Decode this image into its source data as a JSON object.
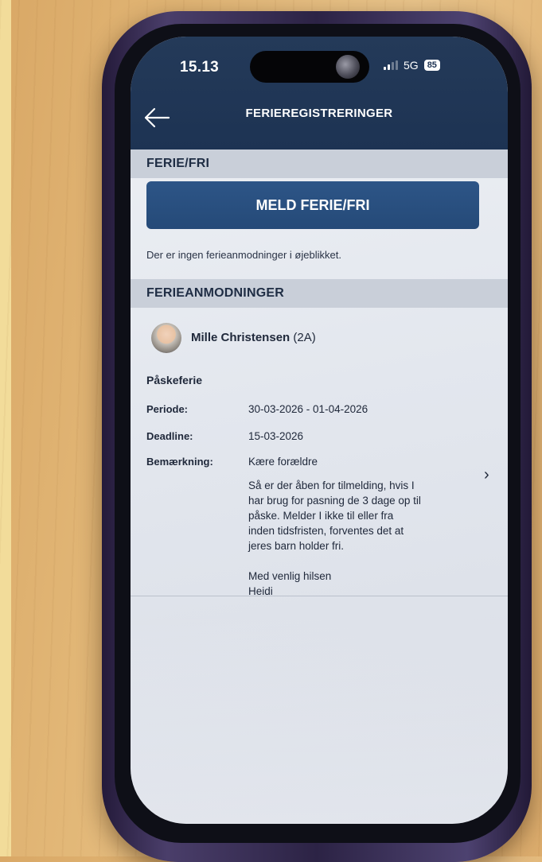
{
  "status_bar": {
    "time": "15.13",
    "network": "5G",
    "battery": "85"
  },
  "header": {
    "back_icon": "arrow-left-icon",
    "title": "FERIEREGISTRERINGER"
  },
  "ferie_fri": {
    "section_title": "FERIE/FRI",
    "button_label": "MELD FERIE/FRI",
    "empty_message": "Der er ingen ferieanmodninger i øjeblikket."
  },
  "ferieanmodninger": {
    "section_title": "FERIEANMODNINGER",
    "student_name": "Mille Christensen",
    "student_class": "(2A)",
    "request": {
      "title": "Påskeferie",
      "periode_label": "Periode:",
      "periode_value": "30-03-2026 - 01-04-2026",
      "deadline_label": "Deadline:",
      "deadline_value": "15-03-2026",
      "remark_label": "Bemærkning:",
      "remark_lines": [
        "Kære forældre",
        "Så er der åben for tilmelding, hvis I",
        "har brug for pasning de 3 dage op til",
        "påske. Melder I ikke til eller fra",
        "inden tidsfristen, forventes det at",
        "jeres barn holder fri.",
        "Med venlig hilsen",
        "Heidi"
      ],
      "chevron_icon": "chevron-right-icon"
    }
  },
  "colors": {
    "header_bg": "#1d3353",
    "button_bg": "#2a5282",
    "section_bg": "#c9cfd9"
  }
}
